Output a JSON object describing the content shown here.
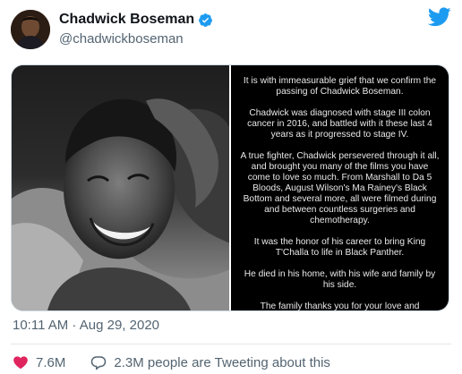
{
  "author": {
    "display_name": "Chadwick Boseman",
    "handle": "@chadwickboseman",
    "verified_icon": "verified-badge-icon",
    "avatar_icon": "profile-avatar"
  },
  "brand": {
    "logo_icon": "twitter-bird-icon",
    "color": "#1d9bf0"
  },
  "media": {
    "photo": "portrait-photo",
    "statement_paragraphs": [
      "It is with immeasurable grief that we confirm the passing of Chadwick Boseman.",
      "Chadwick was diagnosed with stage III colon cancer in 2016, and battled with it these last 4 years as it progressed to stage IV.",
      "A true fighter, Chadwick persevered through it all, and brought you many of the films you have come to love so much. From Marshall to Da 5 Bloods, August Wilson's Ma Rainey's Black Bottom and several more, all were filmed during and between countless surgeries and chemotherapy.",
      "It was the honor of his career to bring King T'Challa to life in Black Panther.",
      "He died in his home, with his wife and family by his side.",
      "The family thanks you for your love and"
    ]
  },
  "tweet": {
    "timestamp": "10:11 AM · Aug 29, 2020"
  },
  "footer": {
    "likes": {
      "icon": "heart-icon",
      "count": "7.6M",
      "color": "#e0245e"
    },
    "conversation": {
      "icon": "reply-bubble-icon",
      "text": "2.3M people are Tweeting about this"
    }
  }
}
